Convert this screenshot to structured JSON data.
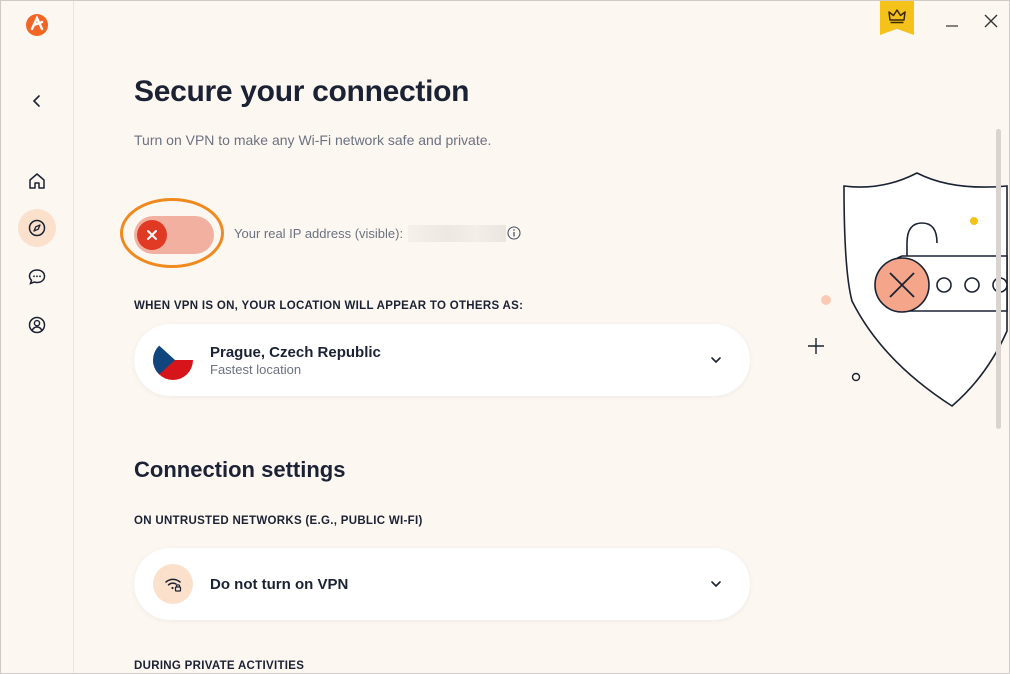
{
  "window": {
    "minimize_icon": "minimize-icon",
    "close_icon": "close-icon",
    "premium_icon": "crown-icon"
  },
  "sidebar": {
    "logo": "avast-logo",
    "items": [
      {
        "name": "back",
        "icon": "chevron-left-icon"
      },
      {
        "name": "home",
        "icon": "home-icon"
      },
      {
        "name": "explore",
        "icon": "compass-icon",
        "active": true
      },
      {
        "name": "support",
        "icon": "chat-icon"
      },
      {
        "name": "account",
        "icon": "user-icon"
      }
    ]
  },
  "main": {
    "title": "Secure your connection",
    "subtitle": "Turn on VPN to make any Wi-Fi network safe and private.",
    "vpn_toggle_state": "off",
    "ip_label": "Your real IP address (visible):",
    "location_heading": "WHEN VPN IS ON, YOUR LOCATION WILL APPEAR TO OTHERS AS:",
    "location": {
      "city": "Prague, Czech Republic",
      "sub": "Fastest location"
    },
    "connection_settings_title": "Connection settings",
    "untrusted_heading": "ON UNTRUSTED NETWORKS (E.G., PUBLIC WI-FI)",
    "untrusted_option": "Do not turn on VPN",
    "private_heading": "DURING PRIVATE ACTIVITIES"
  },
  "colors": {
    "accent": "#f08a1e",
    "toggle_off": "#e03a24",
    "background": "#fdf7f2",
    "premium": "#f5c21b"
  }
}
